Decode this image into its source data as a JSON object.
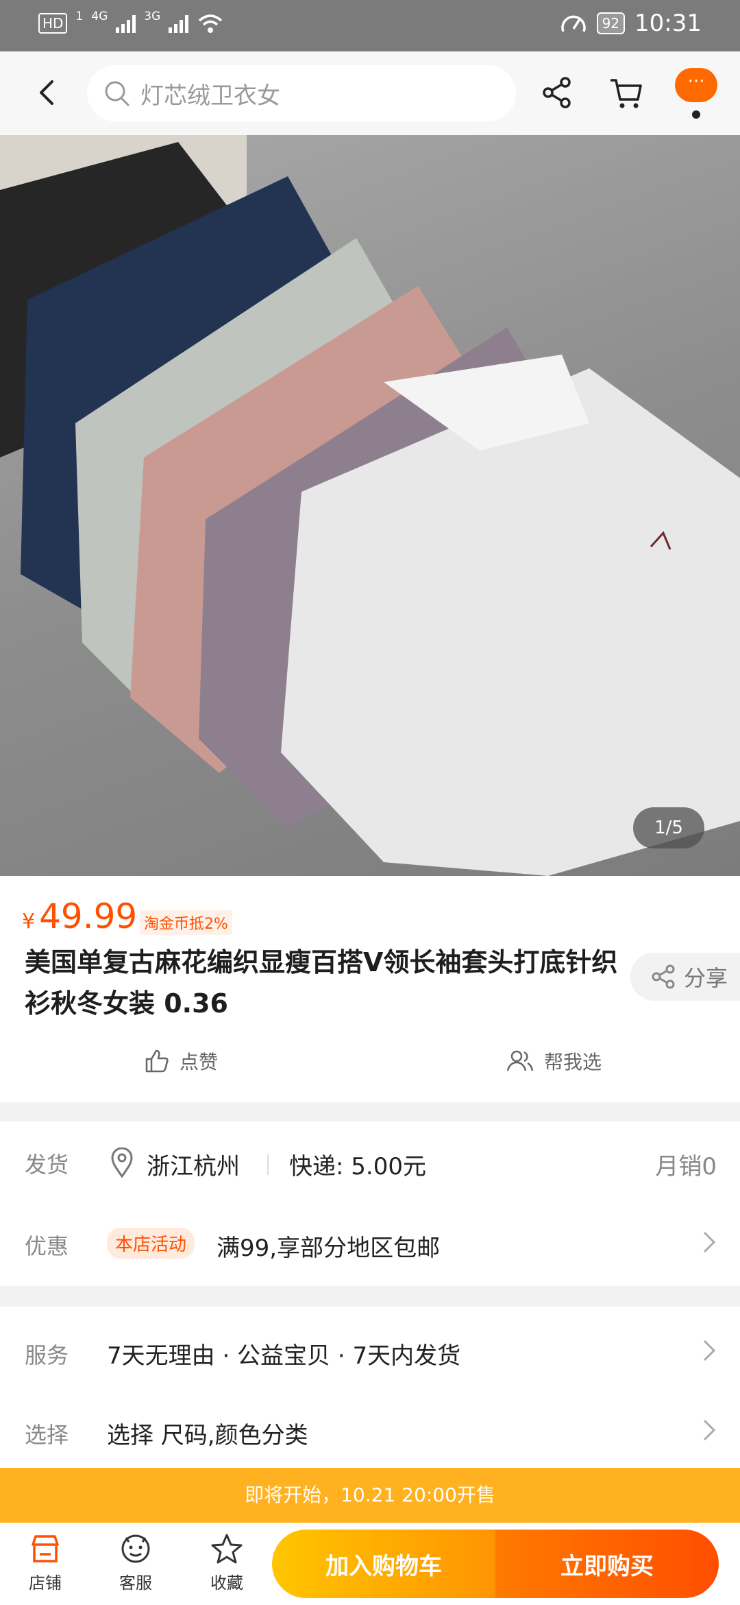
{
  "status_bar": {
    "hd": "HD",
    "sim": "1",
    "net1": "4G",
    "net2": "3G",
    "battery": "92",
    "time": "10:31"
  },
  "search": {
    "placeholder": "灯芯绒卫衣女"
  },
  "top_nav": {
    "more_label": "···"
  },
  "gallery": {
    "indicator": "1/5"
  },
  "product": {
    "currency": "¥",
    "price": "49.99",
    "coin_tag": "淘金币抵2%",
    "title": "美国单复古麻花编织显瘦百搭V领长袖套头打底针织衫秋冬女装 0.36",
    "share_label": "分享",
    "like_label": "点赞",
    "help_choose_label": "帮我选"
  },
  "shipping": {
    "label": "发货",
    "location": "浙江杭州",
    "express": "快递: 5.00元",
    "monthly_sales": "月销0"
  },
  "promo": {
    "label": "优惠",
    "tag": "本店活动",
    "text": "满99,享部分地区包邮"
  },
  "service": {
    "label": "服务",
    "text": "7天无理由 · 公益宝贝 · 7天内发货"
  },
  "options": {
    "label": "选择",
    "text": "选择 尺码,颜色分类"
  },
  "sale_banner": "即将开始，10.21 20:00开售",
  "bottom_bar": {
    "shop": "店铺",
    "service": "客服",
    "favorite": "收藏",
    "add_to_cart": "加入购物车",
    "buy_now": "立即购买"
  },
  "colors": {
    "accent": "#ff5000",
    "banner": "#ffb11f"
  }
}
